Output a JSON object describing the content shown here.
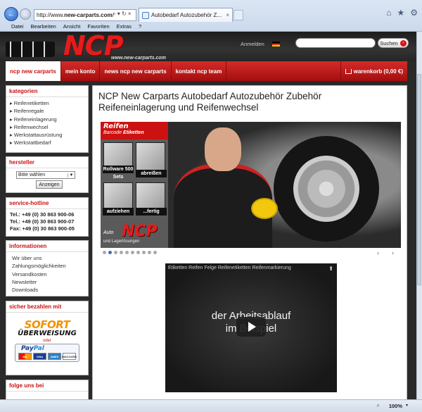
{
  "browser": {
    "url_prefix": "http://www.",
    "url_host": "new-carparts.com",
    "url_suffix": "/",
    "address_tools": "⌕ ▾ ↻ ×",
    "tab_title": "Autobedarf Autozubehör Z...",
    "tab_close": "×",
    "menu": [
      "Datei",
      "Bearbeiten",
      "Ansicht",
      "Favoriten",
      "Extras",
      "?"
    ],
    "home_icon": "⌂",
    "favorites_icon": "★",
    "settings_icon": "⚙",
    "back_icon": "←",
    "forward_icon": "→"
  },
  "header": {
    "logo_text": "NCP",
    "logo_url": "www.new-carparts.com",
    "login": "Anmelden",
    "search_placeholder": "",
    "search_button": "Suchen",
    "search_go": "›"
  },
  "nav": {
    "items": [
      "ncp new carparts",
      "mein konto",
      "news ncp new carparts",
      "kontakt ncp team"
    ],
    "cart": "warenkorb (0,00 €)"
  },
  "sidebar": {
    "categories": {
      "title": "kategorien",
      "items": [
        "Reifenetiketten",
        "Reifenregale",
        "Reifeneinlagerung",
        "Reifenwechsel",
        "Werkstattausrüstung",
        "Werkstattbedarf"
      ]
    },
    "manufacturer": {
      "title": "hersteller",
      "select_value": "Bitte wählen",
      "submit": "Anzeigen"
    },
    "hotline": {
      "title": "service-hotline",
      "lines": [
        "Tel.: +49 (0) 30 863 900-06",
        "Tel.: +49 (0) 30 863 900-07",
        "Fax: +49 (0) 30 863 900-05"
      ]
    },
    "info": {
      "title": "informationen",
      "items": [
        "Wir über uns",
        "Zahlungsmöglichkeiten",
        "Versandkosten",
        "Newsletter",
        "Downloads"
      ]
    },
    "payment": {
      "title": "sicher bezahlen mit",
      "sofort": "SOFORT",
      "ueberweisung": "ÜBERWEISUNG",
      "or": "oder",
      "paypal_a": "Pay",
      "paypal_b": "Pal",
      "cards": [
        "MC",
        "VISA",
        "AMEX",
        "DISCOVER"
      ]
    },
    "follow": {
      "title": "folge uns bei"
    }
  },
  "main": {
    "title": "NCP New Carparts Autobedarf Autozubehör Zubehör Reifeneinlagerung und Reifenwechsel",
    "slider": {
      "panel_title": "Reifen",
      "panel_barcode": "Barcode",
      "panel_etiketten": "Etiketten",
      "captions": [
        "Rollware 500 Sets",
        "abreißen",
        "aufziehen",
        "...fertig"
      ],
      "panel_auto": "Auto",
      "panel_logo": "NCP",
      "panel_sub": "und Lagerlösungen",
      "dots": 10,
      "active_dot": 1,
      "prev": "‹",
      "next": "›"
    },
    "video": {
      "title": "Etiketten Reifen Felge Reifenetiketten Reifenmarkierung",
      "overlay_line1": "der Arbeitsablauf",
      "overlay_line2": "im Beispiel",
      "share_icon": "⬆"
    }
  },
  "status": {
    "zoom": "100%",
    "zoom_icon": "⌕",
    "zoom_arrow": "▾"
  }
}
